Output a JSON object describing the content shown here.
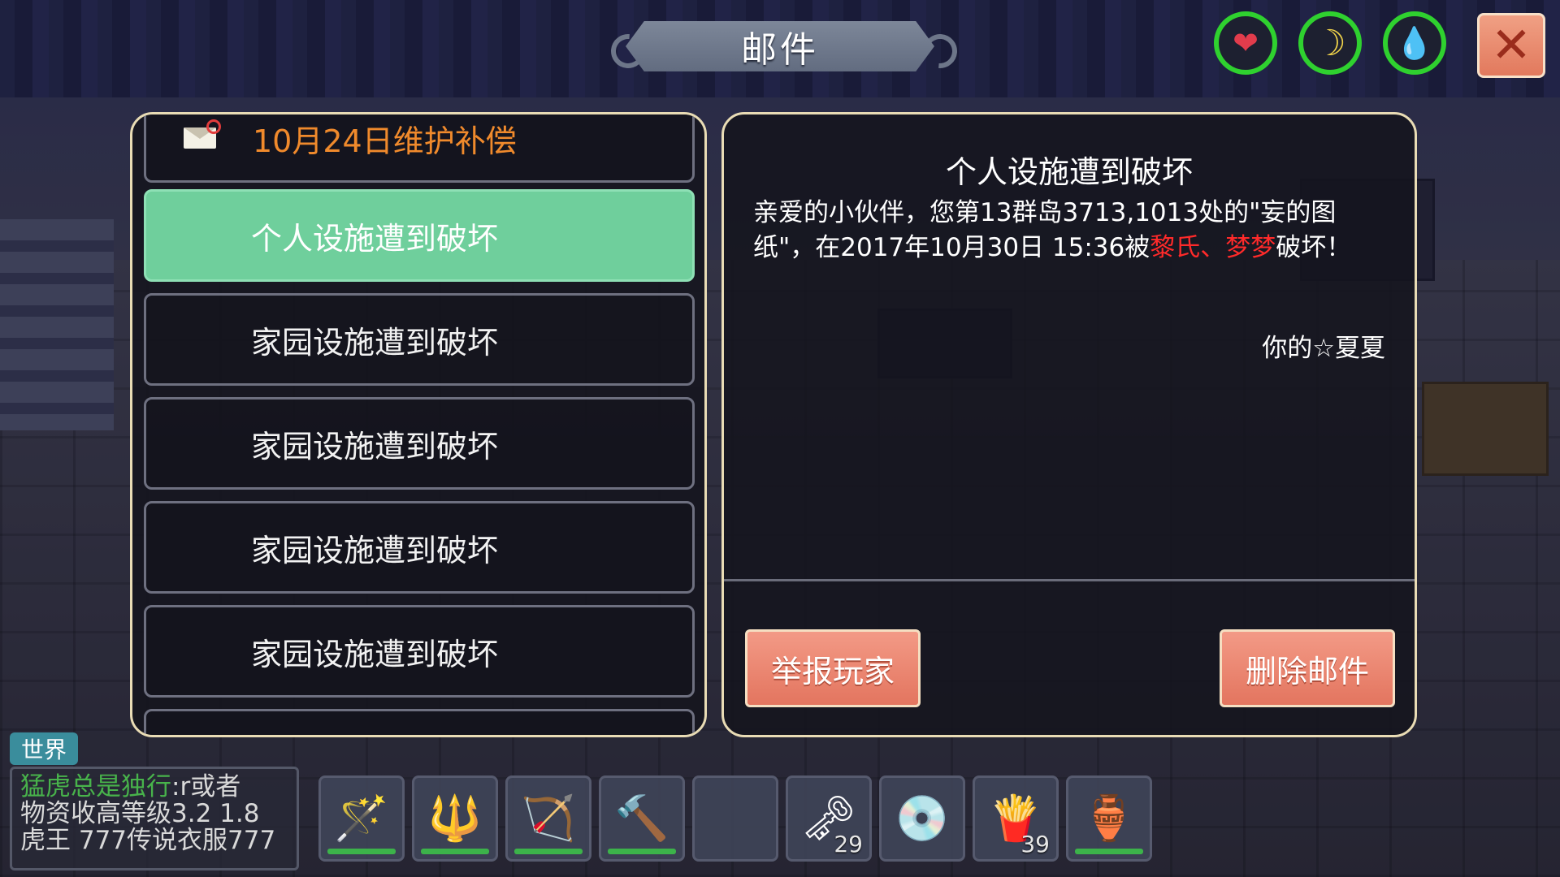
{
  "window": {
    "title": "邮件"
  },
  "status_icons": [
    {
      "name": "heart-icon",
      "glyph": "❤",
      "color": "#e23c4c"
    },
    {
      "name": "banana-icon",
      "glyph": "☽",
      "color": "#f0d34a"
    },
    {
      "name": "water-drop-icon",
      "glyph": "💧",
      "color": "#38c6e0"
    }
  ],
  "close_glyph": "✕",
  "mail_list": {
    "top_item": "10月24日维护补偿",
    "items": [
      {
        "label": "个人设施遭到破坏",
        "selected": true
      },
      {
        "label": "家园设施遭到破坏",
        "selected": false
      },
      {
        "label": "家园设施遭到破坏",
        "selected": false
      },
      {
        "label": "家园设施遭到破坏",
        "selected": false
      },
      {
        "label": "家园设施遭到破坏",
        "selected": false
      }
    ]
  },
  "mail_detail": {
    "title": "个人设施遭到破坏",
    "body_part1": "亲爱的小伙伴，您第13群岛3713,1013处的\"妄的图纸\"，在2017年10月30日 15:36被",
    "body_red": "黎氏、梦梦",
    "body_part2": "破坏！",
    "signature": "你的☆夏夏",
    "report_button": "举报玩家",
    "delete_button": "删除邮件"
  },
  "chat": {
    "tab": "世界",
    "line1_name": "猛虎总是独行",
    "line1_text": ":r或者",
    "line2": "物资收高等级3.2  1.8",
    "line3": "虎王 777传说衣服777"
  },
  "hotbar": [
    {
      "name": "ice-staff-icon",
      "glyph": "🪄",
      "count": "",
      "has_durability": true
    },
    {
      "name": "ice-spear-icon",
      "glyph": "🔱",
      "count": "",
      "has_durability": true
    },
    {
      "name": "bow-icon",
      "glyph": "🏹",
      "count": "",
      "has_durability": true
    },
    {
      "name": "wooden-hammer-icon",
      "glyph": "🔨",
      "count": "",
      "has_durability": true
    },
    {
      "name": "empty-slot",
      "glyph": "",
      "count": "",
      "has_durability": false
    },
    {
      "name": "keys-icon",
      "glyph": "🗝",
      "count": "29",
      "has_durability": false
    },
    {
      "name": "disc-icon",
      "glyph": "💿",
      "count": "",
      "has_durability": false
    },
    {
      "name": "fries-basket-icon",
      "glyph": "🍟",
      "count": "39",
      "has_durability": false
    },
    {
      "name": "water-flask-icon",
      "glyph": "🏺",
      "count": "",
      "has_durability": true
    }
  ]
}
